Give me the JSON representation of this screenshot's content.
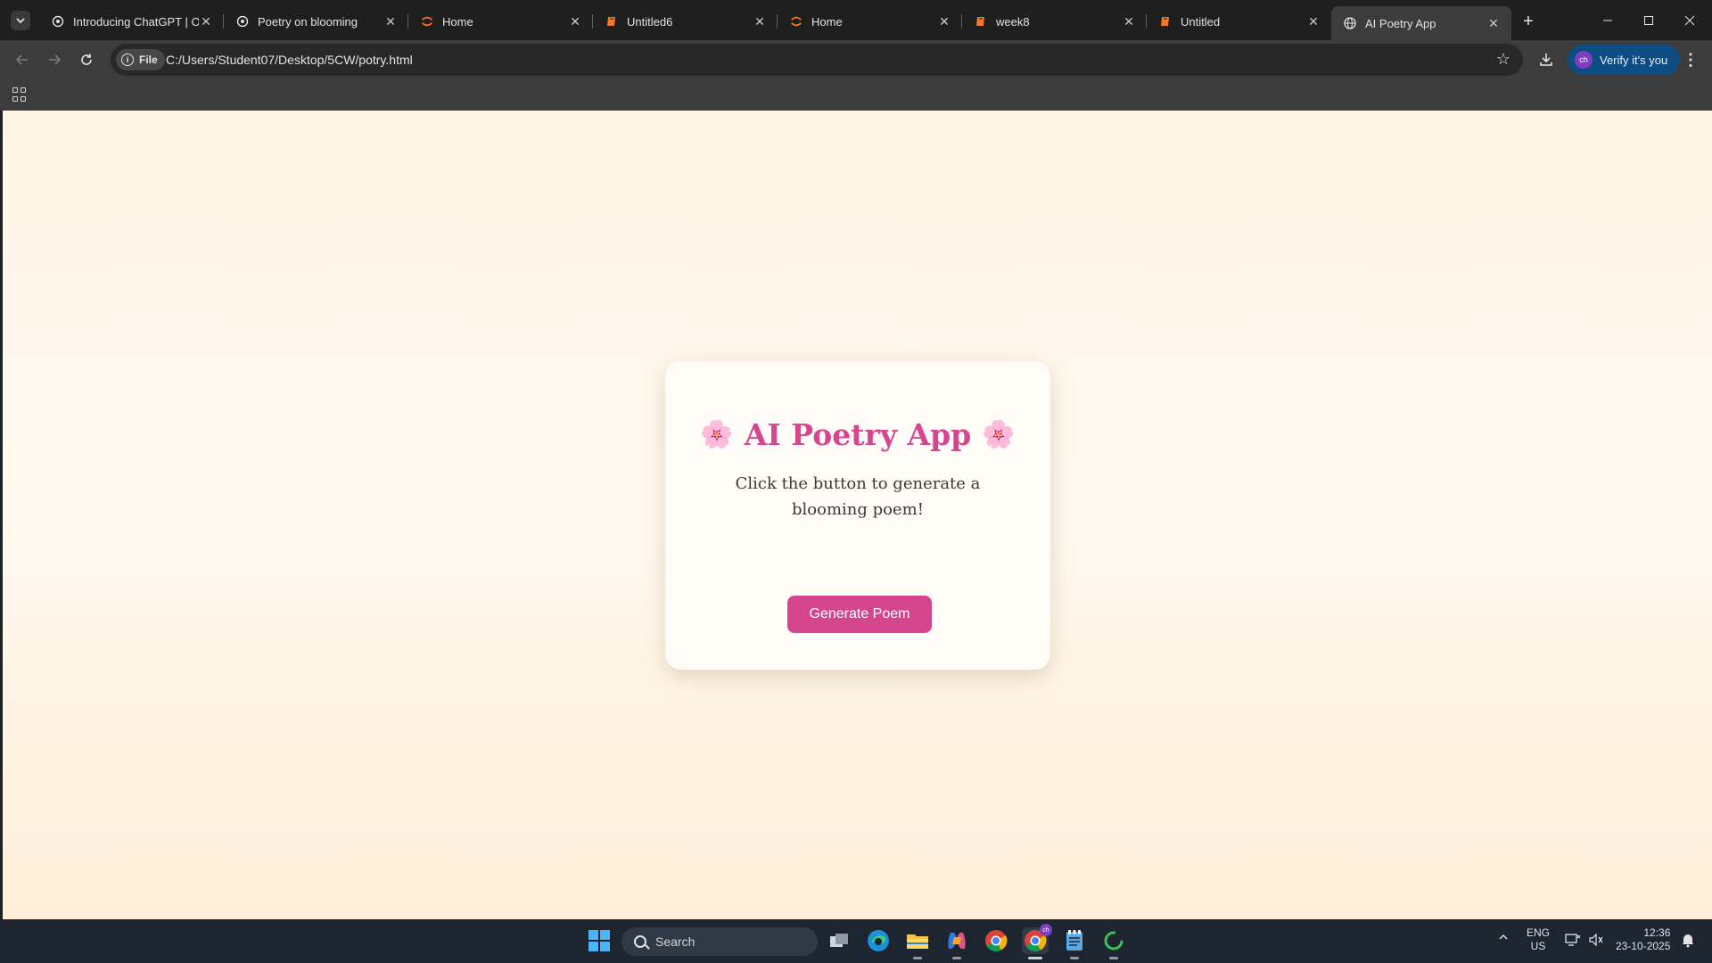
{
  "browser": {
    "tabs": [
      {
        "title": "Introducing ChatGPT | Op",
        "icon": "openai-icon",
        "active": false
      },
      {
        "title": "Poetry on blooming",
        "icon": "openai-icon",
        "active": false
      },
      {
        "title": "Home",
        "icon": "jupyter-icon",
        "active": false
      },
      {
        "title": "Untitled6",
        "icon": "notebook-icon",
        "active": false
      },
      {
        "title": "Home",
        "icon": "jupyter-icon",
        "active": false
      },
      {
        "title": "week8",
        "icon": "notebook-icon",
        "active": false
      },
      {
        "title": "Untitled",
        "icon": "notebook-icon",
        "active": false
      },
      {
        "title": "AI Poetry App",
        "icon": "globe-icon",
        "active": true
      }
    ],
    "address": {
      "chip_label": "File",
      "url": "C:/Users/Student07/Desktop/5CW/potry.html"
    },
    "profile": {
      "initials": "ch",
      "label": "Verify it's you"
    },
    "accent_color": "#0d4d83"
  },
  "page": {
    "title": "AI Poetry App",
    "title_decoration": "🌸",
    "subtitle": "Click the button to generate a blooming poem!",
    "button_label": "Generate Poem",
    "accent_color": "#d6468e",
    "background_color": "#fff5e6"
  },
  "taskbar": {
    "search_placeholder": "Search",
    "lang_top": "ENG",
    "lang_bottom": "US",
    "time": "12:36",
    "date": "23-10-2025",
    "chrome_badge": "ch"
  }
}
